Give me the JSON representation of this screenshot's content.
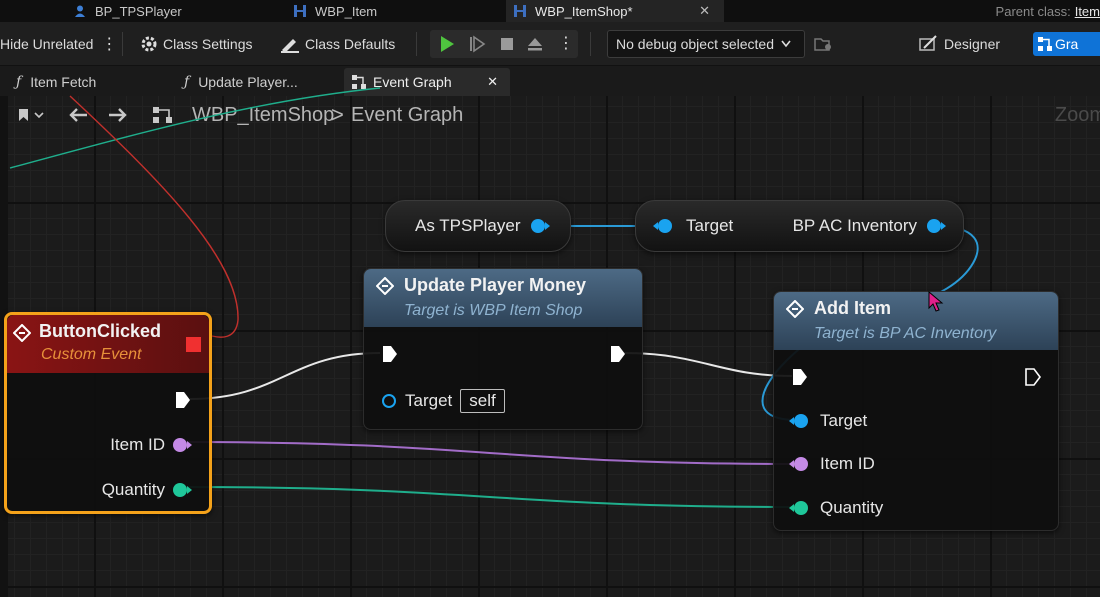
{
  "doc_tabs": [
    {
      "label": "BP_TPSPlayer",
      "icon": "character-icon"
    },
    {
      "label": "WBP_Item",
      "icon": "widget-blueprint-icon"
    },
    {
      "label": "WBP_ItemShop*",
      "icon": "widget-blueprint-icon",
      "active": true,
      "close": "✕"
    }
  ],
  "parent_class": {
    "label": "Parent class:",
    "value": "Item"
  },
  "toolbar": {
    "hide_unrelated": "Hide Unrelated",
    "class_settings": "Class Settings",
    "class_defaults": "Class Defaults",
    "debug_object": "No debug object selected",
    "designer": "Designer",
    "graph": "Gra"
  },
  "graph_tabs": [
    {
      "label": "Item Fetch",
      "icon": "function-icon"
    },
    {
      "label": "Update Player...",
      "icon": "function-icon"
    },
    {
      "label": "Event Graph",
      "icon": "event-graph-icon",
      "active": true,
      "close": "✕"
    }
  ],
  "breadcrumb": {
    "root": "WBP_ItemShop",
    "separator": ">",
    "current": "Event Graph",
    "zoom": "Zoom"
  },
  "nodes": {
    "button_clicked": {
      "title": "ButtonClicked",
      "subtitle": "Custom Event",
      "pins": {
        "item_id": "Item ID",
        "quantity": "Quantity"
      }
    },
    "as_tps_player": {
      "label": "As TPSPlayer"
    },
    "bp_ac_inventory": {
      "target": "Target",
      "output": "BP AC Inventory"
    },
    "update_player_money": {
      "title": "Update Player Money",
      "subtitle": "Target is WBP Item Shop",
      "target": "Target",
      "self": "self"
    },
    "add_item": {
      "title": "Add Item",
      "subtitle": "Target is BP AC Inventory",
      "pins": {
        "target": "Target",
        "item_id": "Item ID",
        "quantity": "Quantity"
      }
    }
  },
  "colors": {
    "object_pin": "#1aa3f0",
    "integer_pin": "#c77de0",
    "struct_pin": "#1fc79a",
    "event_header": "#8a1515",
    "function_header": "#34506a",
    "selection": "#f4a21a"
  }
}
